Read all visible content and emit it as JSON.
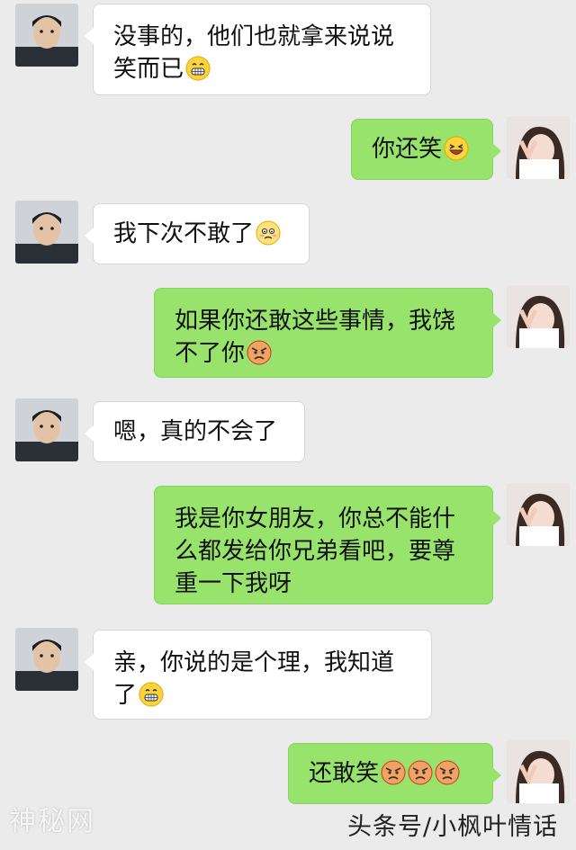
{
  "conversation": [
    {
      "side": "in",
      "lines": [
        "没事的，他们也就拿来说说",
        "笑而已"
      ],
      "emoji": [
        "grin"
      ]
    },
    {
      "side": "out",
      "lines": [
        "你还笑"
      ],
      "emoji": [
        "laugh"
      ]
    },
    {
      "side": "in",
      "lines": [
        "我下次不敢了"
      ],
      "emoji": [
        "embarrassed"
      ]
    },
    {
      "side": "out",
      "lines": [
        "如果你还敢这些事情，我饶",
        "不了你"
      ],
      "emoji": [
        "angry"
      ]
    },
    {
      "side": "in",
      "lines": [
        "嗯，真的不会了"
      ],
      "emoji": []
    },
    {
      "side": "out",
      "lines": [
        "我是你女朋友，你总不能什",
        "么都发给你兄弟看吧，要尊",
        "重一下我呀"
      ],
      "emoji": []
    },
    {
      "side": "in",
      "lines": [
        "亲，你说的是个理，我知道",
        "了"
      ],
      "emoji": [
        "grin"
      ]
    },
    {
      "side": "out",
      "lines": [
        "还敢笑"
      ],
      "emoji": [
        "angry",
        "angry",
        "angry"
      ]
    }
  ],
  "watermarks": {
    "left": "神秘网",
    "right": "头条号/小枫叶情话"
  },
  "colors": {
    "background": "#ebebeb",
    "incoming_bubble": "#ffffff",
    "outgoing_bubble": "#97e36b"
  }
}
